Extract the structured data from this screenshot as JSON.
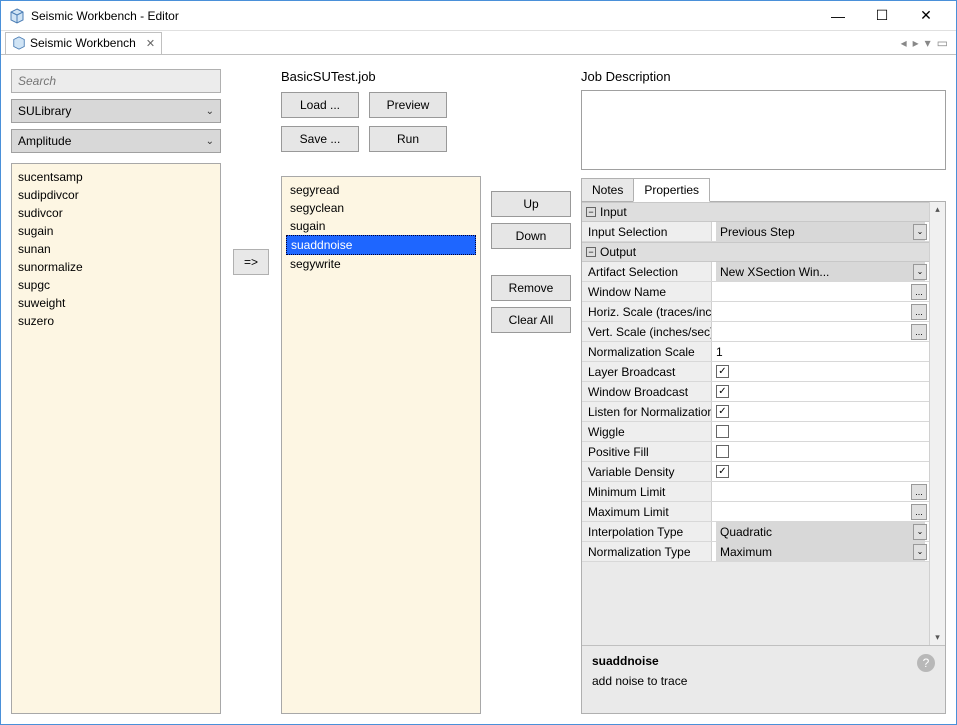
{
  "window": {
    "title": "Seismic Workbench - Editor"
  },
  "tab": {
    "label": "Seismic Workbench"
  },
  "search": {
    "placeholder": "Search"
  },
  "library_combo": {
    "value": "SULibrary"
  },
  "category_combo": {
    "value": "Amplitude"
  },
  "functions": [
    "sucentsamp",
    "sudipdivcor",
    "sudivcor",
    "sugain",
    "sunan",
    "sunormalize",
    "supgc",
    "suweight",
    "suzero"
  ],
  "arrow_label": "=>",
  "job": {
    "title": "BasicSUTest.job",
    "buttons": {
      "load": "Load ...",
      "preview": "Preview",
      "save": "Save ...",
      "run": "Run"
    },
    "steps": [
      "segyread",
      "segyclean",
      "sugain",
      "suaddnoise",
      "segywrite"
    ],
    "selected_index": 3
  },
  "step_buttons": {
    "up": "Up",
    "down": "Down",
    "remove": "Remove",
    "clear": "Clear All"
  },
  "desc": {
    "label": "Job Description",
    "value": ""
  },
  "tabs": {
    "notes": "Notes",
    "properties": "Properties"
  },
  "props": {
    "groups": {
      "input": {
        "label": "Input",
        "rows": [
          {
            "key": "Input Selection",
            "type": "dropdown",
            "value": "Previous Step"
          }
        ]
      },
      "output": {
        "label": "Output",
        "rows": [
          {
            "key": "Artifact Selection",
            "type": "dropdown",
            "value": "New XSection Win..."
          },
          {
            "key": "Window Name",
            "type": "dots",
            "value": ""
          },
          {
            "key": "Horiz. Scale (traces/inch",
            "type": "dots",
            "value": ""
          },
          {
            "key": "Vert. Scale (inches/sec)",
            "type": "dots",
            "value": ""
          },
          {
            "key": "Normalization Scale",
            "type": "text",
            "value": "1"
          },
          {
            "key": "Layer Broadcast",
            "type": "check",
            "checked": true
          },
          {
            "key": "Window Broadcast",
            "type": "check",
            "checked": true
          },
          {
            "key": "Listen for Normalization",
            "type": "check",
            "checked": true
          },
          {
            "key": "Wiggle",
            "type": "check",
            "checked": false
          },
          {
            "key": "Positive Fill",
            "type": "check",
            "checked": false
          },
          {
            "key": "Variable Density",
            "type": "check",
            "checked": true
          },
          {
            "key": "Minimum Limit",
            "type": "dots",
            "value": ""
          },
          {
            "key": "Maximum Limit",
            "type": "dots",
            "value": ""
          },
          {
            "key": "Interpolation Type",
            "type": "dropdown",
            "value": "Quadratic"
          },
          {
            "key": "Normalization Type",
            "type": "dropdown",
            "value": "Maximum"
          }
        ]
      }
    }
  },
  "help": {
    "name": "suaddnoise",
    "desc": "add noise to trace"
  }
}
